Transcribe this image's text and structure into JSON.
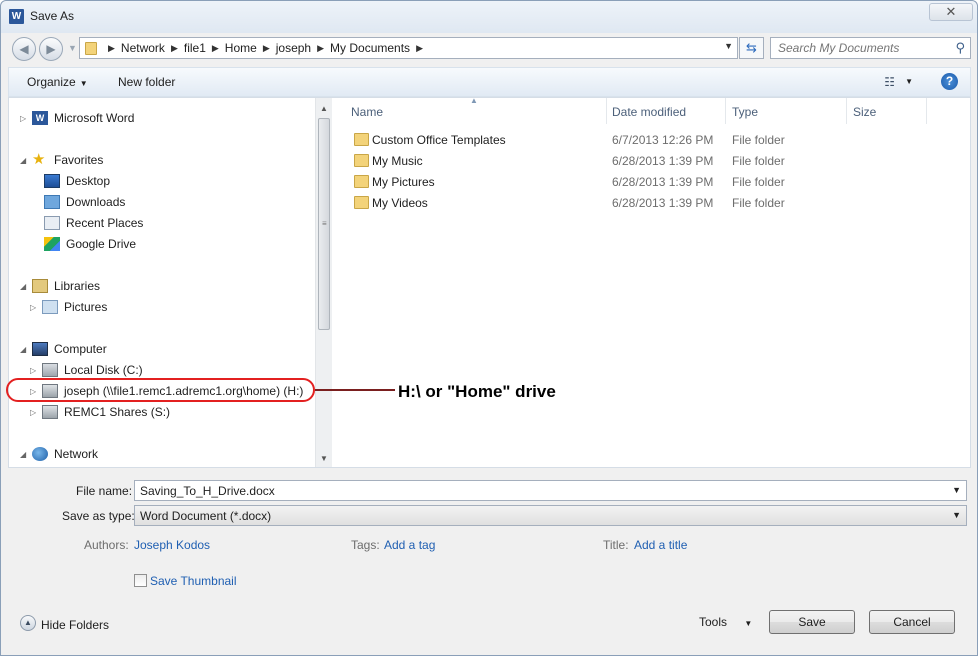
{
  "window": {
    "title": "Save As",
    "close_glyph": "✕",
    "app_icon_letter": "W"
  },
  "nav": {
    "back_glyph": "◀",
    "forward_glyph": "▶"
  },
  "address": {
    "crumbs": [
      "Network",
      "file1",
      "Home",
      "joseph",
      "My Documents"
    ]
  },
  "search": {
    "placeholder": "Search My Documents"
  },
  "toolbar": {
    "organize_label": "Organize",
    "new_folder_label": "New folder",
    "help_label": "?"
  },
  "tree": {
    "microsoft_word": "Microsoft Word",
    "favorites": "Favorites",
    "desktop": "Desktop",
    "downloads": "Downloads",
    "recent_places": "Recent Places",
    "google_drive": "Google Drive",
    "libraries": "Libraries",
    "pictures": "Pictures",
    "computer": "Computer",
    "local_disk": "Local Disk (C:)",
    "home_drive": "joseph (\\\\file1.remc1.adremc1.org\\home) (H:)",
    "shares_drive": "REMC1 Shares (S:)",
    "network": "Network"
  },
  "columns": {
    "name": "Name",
    "date_modified": "Date modified",
    "type": "Type",
    "size": "Size"
  },
  "files": [
    {
      "name": "Custom Office Templates",
      "date": "6/7/2013 12:26 PM",
      "type": "File folder",
      "icon": "folder-icon"
    },
    {
      "name": "My Music",
      "date": "6/28/2013 1:39 PM",
      "type": "File folder",
      "icon": "music-folder-icon"
    },
    {
      "name": "My Pictures",
      "date": "6/28/2013 1:39 PM",
      "type": "File folder",
      "icon": "pictures-folder-icon"
    },
    {
      "name": "My Videos",
      "date": "6/28/2013 1:39 PM",
      "type": "File folder",
      "icon": "videos-folder-icon"
    }
  ],
  "form": {
    "file_name_label": "File name:",
    "file_name_value": "Saving_To_H_Drive.docx",
    "save_type_label": "Save as type:",
    "save_type_value": "Word Document (*.docx)",
    "authors_label": "Authors:",
    "authors_value": "Joseph Kodos",
    "tags_label": "Tags:",
    "tags_value": "Add a tag",
    "title_label": "Title:",
    "title_value": "Add a title",
    "thumbnail_label": "Save Thumbnail"
  },
  "footer": {
    "hide_folders_label": "Hide Folders",
    "tools_label": "Tools",
    "save_label": "Save",
    "cancel_label": "Cancel"
  },
  "annotation": {
    "text": "H:\\ or \"Home\" drive",
    "color": "#e32020"
  }
}
